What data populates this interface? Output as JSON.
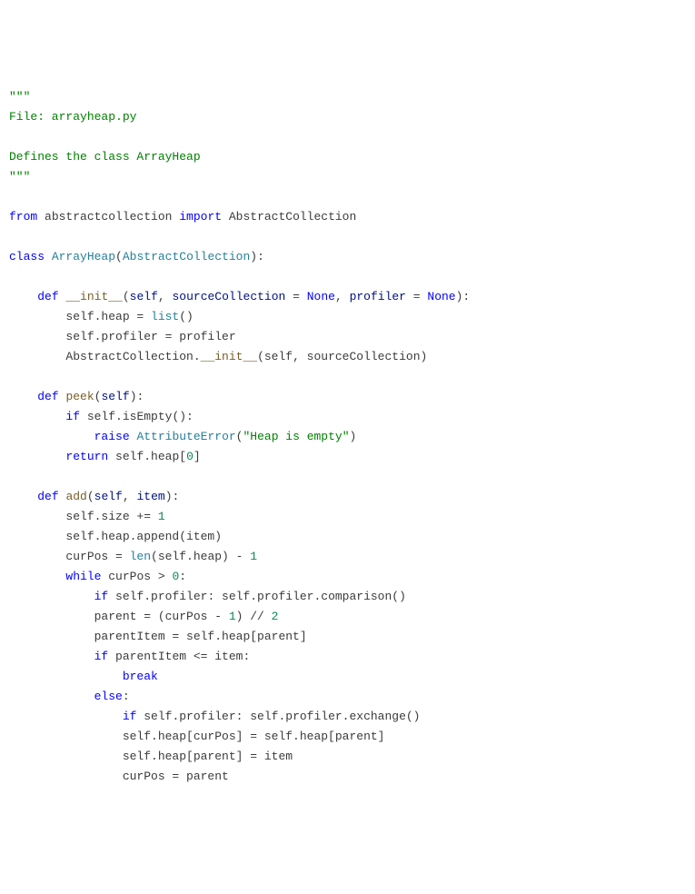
{
  "lines": [
    [
      {
        "cls": "docstring",
        "t": "\"\"\""
      }
    ],
    [
      {
        "cls": "docstring",
        "t": "File: arrayheap.py"
      }
    ],
    [
      {
        "cls": "docstring",
        "t": ""
      }
    ],
    [
      {
        "cls": "docstring",
        "t": "Defines the class ArrayHeap"
      }
    ],
    [
      {
        "cls": "docstring",
        "t": "\"\"\""
      }
    ],
    [
      {
        "cls": "",
        "t": ""
      }
    ],
    [
      {
        "cls": "kw",
        "t": "from"
      },
      {
        "cls": "",
        "t": " abstractcollection "
      },
      {
        "cls": "kw",
        "t": "import"
      },
      {
        "cls": "",
        "t": " AbstractCollection"
      }
    ],
    [
      {
        "cls": "",
        "t": ""
      }
    ],
    [
      {
        "cls": "kw",
        "t": "class"
      },
      {
        "cls": "",
        "t": " "
      },
      {
        "cls": "cls",
        "t": "ArrayHeap"
      },
      {
        "cls": "",
        "t": "("
      },
      {
        "cls": "cls",
        "t": "AbstractCollection"
      },
      {
        "cls": "",
        "t": "):"
      }
    ],
    [
      {
        "cls": "",
        "t": ""
      }
    ],
    [
      {
        "cls": "",
        "t": "    "
      },
      {
        "cls": "kw",
        "t": "def"
      },
      {
        "cls": "",
        "t": " "
      },
      {
        "cls": "dunder",
        "t": "__init__"
      },
      {
        "cls": "",
        "t": "("
      },
      {
        "cls": "prm",
        "t": "self"
      },
      {
        "cls": "",
        "t": ", "
      },
      {
        "cls": "prm",
        "t": "sourceCollection"
      },
      {
        "cls": "",
        "t": " = "
      },
      {
        "cls": "const",
        "t": "None"
      },
      {
        "cls": "",
        "t": ", "
      },
      {
        "cls": "prm",
        "t": "profiler"
      },
      {
        "cls": "",
        "t": " = "
      },
      {
        "cls": "const",
        "t": "None"
      },
      {
        "cls": "",
        "t": "):"
      }
    ],
    [
      {
        "cls": "",
        "t": "        self.heap = "
      },
      {
        "cls": "builtin",
        "t": "list"
      },
      {
        "cls": "",
        "t": "()"
      }
    ],
    [
      {
        "cls": "",
        "t": "        self.profiler = profiler"
      }
    ],
    [
      {
        "cls": "",
        "t": "        AbstractCollection."
      },
      {
        "cls": "dunder",
        "t": "__init__"
      },
      {
        "cls": "",
        "t": "(self, sourceCollection)"
      }
    ],
    [
      {
        "cls": "",
        "t": ""
      }
    ],
    [
      {
        "cls": "",
        "t": "    "
      },
      {
        "cls": "kw",
        "t": "def"
      },
      {
        "cls": "",
        "t": " "
      },
      {
        "cls": "fn",
        "t": "peek"
      },
      {
        "cls": "",
        "t": "("
      },
      {
        "cls": "prm",
        "t": "self"
      },
      {
        "cls": "",
        "t": "):"
      }
    ],
    [
      {
        "cls": "",
        "t": "        "
      },
      {
        "cls": "kw",
        "t": "if"
      },
      {
        "cls": "",
        "t": " self.isEmpty():"
      }
    ],
    [
      {
        "cls": "",
        "t": "            "
      },
      {
        "cls": "kw",
        "t": "raise"
      },
      {
        "cls": "",
        "t": " "
      },
      {
        "cls": "cls",
        "t": "AttributeError"
      },
      {
        "cls": "",
        "t": "("
      },
      {
        "cls": "str",
        "t": "\"Heap is empty\""
      },
      {
        "cls": "",
        "t": ")"
      }
    ],
    [
      {
        "cls": "",
        "t": "        "
      },
      {
        "cls": "kw",
        "t": "return"
      },
      {
        "cls": "",
        "t": " self.heap["
      },
      {
        "cls": "num",
        "t": "0"
      },
      {
        "cls": "",
        "t": "]"
      }
    ],
    [
      {
        "cls": "",
        "t": ""
      }
    ],
    [
      {
        "cls": "",
        "t": "    "
      },
      {
        "cls": "kw",
        "t": "def"
      },
      {
        "cls": "",
        "t": " "
      },
      {
        "cls": "fn",
        "t": "add"
      },
      {
        "cls": "",
        "t": "("
      },
      {
        "cls": "prm",
        "t": "self"
      },
      {
        "cls": "",
        "t": ", "
      },
      {
        "cls": "prm",
        "t": "item"
      },
      {
        "cls": "",
        "t": "):"
      }
    ],
    [
      {
        "cls": "",
        "t": "        self.size += "
      },
      {
        "cls": "num",
        "t": "1"
      }
    ],
    [
      {
        "cls": "",
        "t": "        self.heap.append(item)"
      }
    ],
    [
      {
        "cls": "",
        "t": "        curPos = "
      },
      {
        "cls": "builtin",
        "t": "len"
      },
      {
        "cls": "",
        "t": "(self.heap) - "
      },
      {
        "cls": "num",
        "t": "1"
      }
    ],
    [
      {
        "cls": "",
        "t": "        "
      },
      {
        "cls": "kw",
        "t": "while"
      },
      {
        "cls": "",
        "t": " curPos > "
      },
      {
        "cls": "num",
        "t": "0"
      },
      {
        "cls": "",
        "t": ":"
      }
    ],
    [
      {
        "cls": "",
        "t": "            "
      },
      {
        "cls": "kw",
        "t": "if"
      },
      {
        "cls": "",
        "t": " self.profiler: self.profiler.comparison()"
      }
    ],
    [
      {
        "cls": "",
        "t": "            parent = (curPos - "
      },
      {
        "cls": "num",
        "t": "1"
      },
      {
        "cls": "",
        "t": ") // "
      },
      {
        "cls": "num",
        "t": "2"
      }
    ],
    [
      {
        "cls": "",
        "t": "            parentItem = self.heap[parent]"
      }
    ],
    [
      {
        "cls": "",
        "t": "            "
      },
      {
        "cls": "kw",
        "t": "if"
      },
      {
        "cls": "",
        "t": " parentItem <= item:"
      }
    ],
    [
      {
        "cls": "",
        "t": "                "
      },
      {
        "cls": "kw",
        "t": "break"
      }
    ],
    [
      {
        "cls": "",
        "t": "            "
      },
      {
        "cls": "kw",
        "t": "else"
      },
      {
        "cls": "",
        "t": ":"
      }
    ],
    [
      {
        "cls": "",
        "t": "                "
      },
      {
        "cls": "kw",
        "t": "if"
      },
      {
        "cls": "",
        "t": " self.profiler: self.profiler.exchange()"
      }
    ],
    [
      {
        "cls": "",
        "t": "                self.heap[curPos] = self.heap[parent]"
      }
    ],
    [
      {
        "cls": "",
        "t": "                self.heap[parent] = item"
      }
    ],
    [
      {
        "cls": "",
        "t": "                curPos = parent"
      }
    ]
  ]
}
